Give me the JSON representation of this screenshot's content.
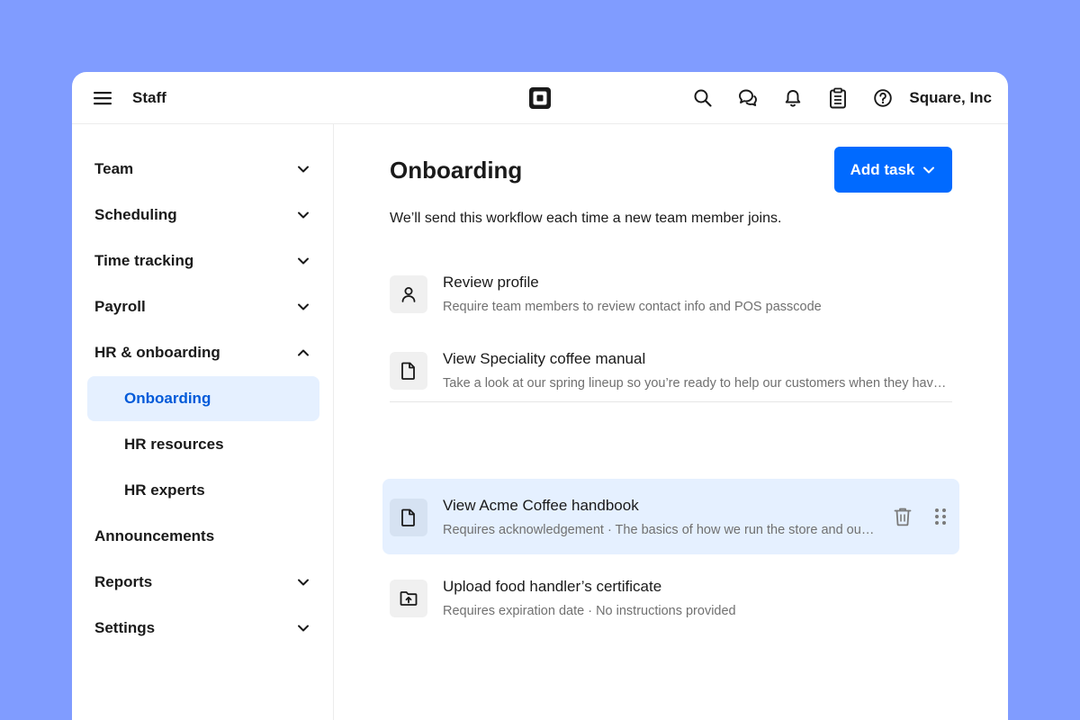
{
  "header": {
    "app_title": "Staff",
    "account_name": "Square, Inc"
  },
  "icons": {
    "menu": "hamburger-icon",
    "logo": "square-logo",
    "search": "search-icon",
    "messages": "chat-icon",
    "notifications": "bell-icon",
    "tasks": "clipboard-icon",
    "help": "question-icon"
  },
  "sidebar": {
    "items": [
      {
        "label": "Team",
        "chevron": "down"
      },
      {
        "label": "Scheduling",
        "chevron": "down"
      },
      {
        "label": "Time tracking",
        "chevron": "down"
      },
      {
        "label": "Payroll",
        "chevron": "down"
      },
      {
        "label": "HR & onboarding",
        "chevron": "up"
      },
      {
        "label": "Onboarding",
        "sub": true,
        "active": true
      },
      {
        "label": "HR resources",
        "sub": true
      },
      {
        "label": "HR experts",
        "sub": true
      },
      {
        "label": "Announcements"
      },
      {
        "label": "Reports",
        "chevron": "down"
      },
      {
        "label": "Settings",
        "chevron": "down"
      }
    ]
  },
  "main": {
    "title": "Onboarding",
    "add_task_label": "Add task",
    "description": "We’ll send this workflow each time a new team member joins.",
    "tasks": [
      {
        "title": "Review profile",
        "subtitle": "Require team members to review contact info and POS passcode",
        "icon": "person-icon"
      },
      {
        "title": "View Speciality coffee manual",
        "subtitle": "Take a look at our spring lineup so you’re ready to help our customers when they have questions",
        "icon": "document-icon"
      },
      {
        "title": "View Acme Coffee handbook",
        "subtitle": "Requires acknowledgement · The basics of how we run the store and our policies",
        "icon": "document-icon"
      },
      {
        "title": "Upload food handler’s certificate",
        "subtitle": "Requires expiration date · No instructions provided",
        "icon": "folder-upload-icon"
      }
    ]
  },
  "colors": {
    "background": "#809cff",
    "accent": "#006aff",
    "active_bg": "#e5f0ff",
    "active_text": "#005ad9"
  }
}
